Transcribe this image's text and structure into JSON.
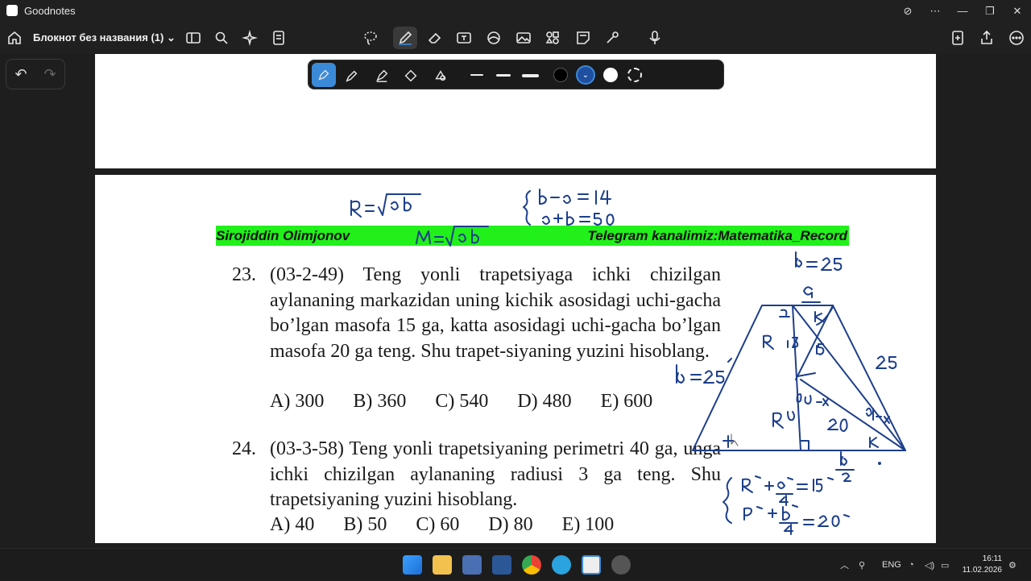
{
  "window": {
    "app_title": "Goodnotes"
  },
  "toolbar": {
    "notebook_title": "Блокнот без названия (1)",
    "icons": [
      "home-icon",
      "sidebar-icon",
      "search-icon",
      "sparkle-icon",
      "document-icon",
      "lasso-icon",
      "pen-icon",
      "eraser-icon",
      "textbox-icon",
      "shapes-icon",
      "image-icon",
      "elements-icon",
      "sticky-note-icon",
      "laser-icon",
      "microphone-icon",
      "add-page-icon",
      "share-icon",
      "more-icon"
    ]
  },
  "pen_tools": {
    "icons": [
      "fountain-pen-icon",
      "ballpoint-pen-icon",
      "brush-pen-icon",
      "highlighter-icon",
      "shape-pen-icon"
    ],
    "colors": [
      "#000000",
      "#1e4fa0",
      "#ffffff"
    ]
  },
  "page": {
    "banner_left": "Sirojiddin Olimjonov",
    "banner_right": "Telegram kanalimiz:Matematika_Record",
    "problem23": {
      "number": "23.",
      "text": "(03-2-49) Teng yonli trapetsiyaga ichki chizilgan aylananing markazidan uning kichik asosidagi uchi-gacha bo’lgan masofa 15 ga, katta asosidagi uchi-gacha bo’lgan masofa 20 ga teng. Shu trapet-siyaning yuzini hisoblang.",
      "answers": [
        "A) 300",
        "B) 360",
        "C) 540",
        "D) 480",
        "E) 600"
      ]
    },
    "problem24": {
      "number": "24.",
      "text": "(03-3-58) Teng yonli trapetsiyaning perimetri 40 ga, unga ichki chizilgan aylananing radiusi 3 ga teng. Shu trapetsiyaning yuzini hisoblang.",
      "answers": [
        "A) 40",
        "B) 50",
        "C) 60",
        "D) 80",
        "E) 100"
      ]
    }
  },
  "taskbar": {
    "language": "ENG",
    "time": "16:11",
    "date": "11.02.2026"
  }
}
